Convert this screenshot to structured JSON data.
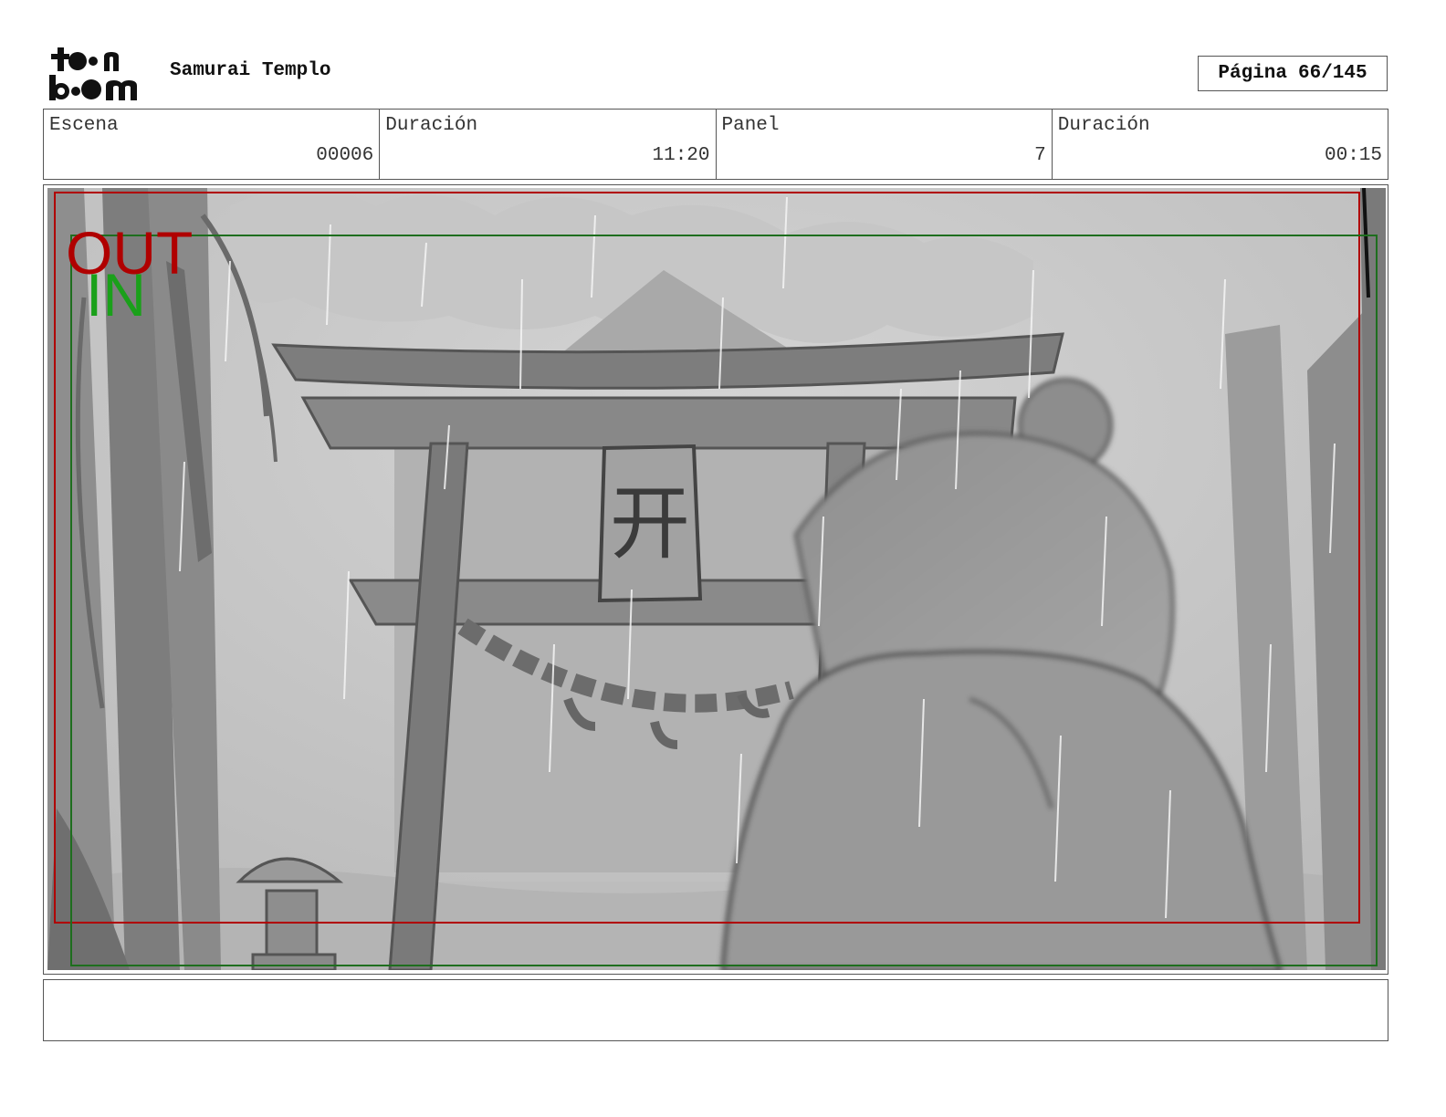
{
  "header": {
    "logo_text": "toonboom",
    "project_title": "Samurai Templo",
    "page_label": "Página",
    "page_value": "66/145"
  },
  "info": [
    {
      "label": "Escena",
      "value": "00006"
    },
    {
      "label": "Duración",
      "value": "11:20"
    },
    {
      "label": "Panel",
      "value": "7"
    },
    {
      "label": "Duración",
      "value": "00:15"
    }
  ],
  "panel": {
    "out_label": "OUT",
    "in_label": "IN",
    "out_color": "#b00000",
    "in_color": "#1aa01a",
    "sign_glyph": "开"
  },
  "notes": {
    "text": ""
  }
}
